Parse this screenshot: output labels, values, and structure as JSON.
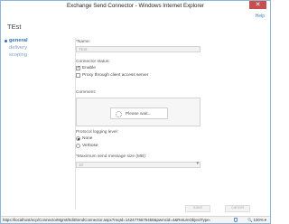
{
  "window": {
    "title": "Exchange Send Connector - Windows Internet Explorer",
    "close_glyph": "✕"
  },
  "header": {
    "help": "Help"
  },
  "page_title": "TEst",
  "nav": {
    "items": [
      {
        "label": "general",
        "active": true
      },
      {
        "label": "delivery"
      },
      {
        "label": "scoping"
      }
    ]
  },
  "form": {
    "name_label": "*Name:",
    "name_value": "TEst",
    "connector_status_label": "Connector status:",
    "enable_label": "Enable",
    "enable_checked": true,
    "proxy_label": "Proxy through client access server",
    "proxy_checked": false,
    "comment_label": "Comment:",
    "loading_text": "Please wait...",
    "protocol_label": "Protocol logging level:",
    "protocol_options": [
      {
        "label": "None",
        "selected": true
      },
      {
        "label": "Verbose",
        "selected": false
      }
    ],
    "max_size_label": "*Maximum send message size (MB):",
    "max_size_value": "10",
    "max_size_arrow": "▾"
  },
  "buttons": {
    "save": "save",
    "cancel": "cancel"
  },
  "statusbar": {
    "url": "https://localhost/ecp/ConnectorMgmt/EditSendConnector.aspx?reqId=1424776675458&pwmcid=4&ReturnObjectType=1&ic",
    "zoom": "100%",
    "zoom_icon": "🔍",
    "zoom_caret": "▾"
  },
  "colors": {
    "accent": "#2f6fb3",
    "close": "#c7504f",
    "border": "#8fb7d8"
  }
}
